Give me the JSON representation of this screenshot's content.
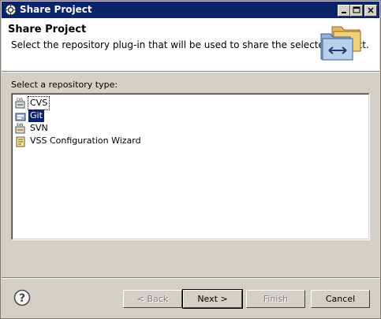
{
  "window": {
    "title": "Share Project"
  },
  "header": {
    "title": "Share Project",
    "description": "Select the repository plug-in that will be used to share the selected project."
  },
  "repo_list": {
    "label": "Select a repository type:",
    "items": [
      {
        "label": "CVS",
        "icon": "cvs-icon",
        "state": "focused"
      },
      {
        "label": "Git",
        "icon": "git-icon",
        "state": "selected"
      },
      {
        "label": "SVN",
        "icon": "svn-icon",
        "state": "normal"
      },
      {
        "label": "VSS Configuration Wizard",
        "icon": "vss-icon",
        "state": "normal"
      }
    ]
  },
  "buttons": {
    "back": "< Back",
    "next": "Next >",
    "finish": "Finish",
    "cancel": "Cancel"
  },
  "colors": {
    "titlebar": "#0a246a",
    "selection": "#0a246a",
    "face": "#d4d0c8"
  }
}
